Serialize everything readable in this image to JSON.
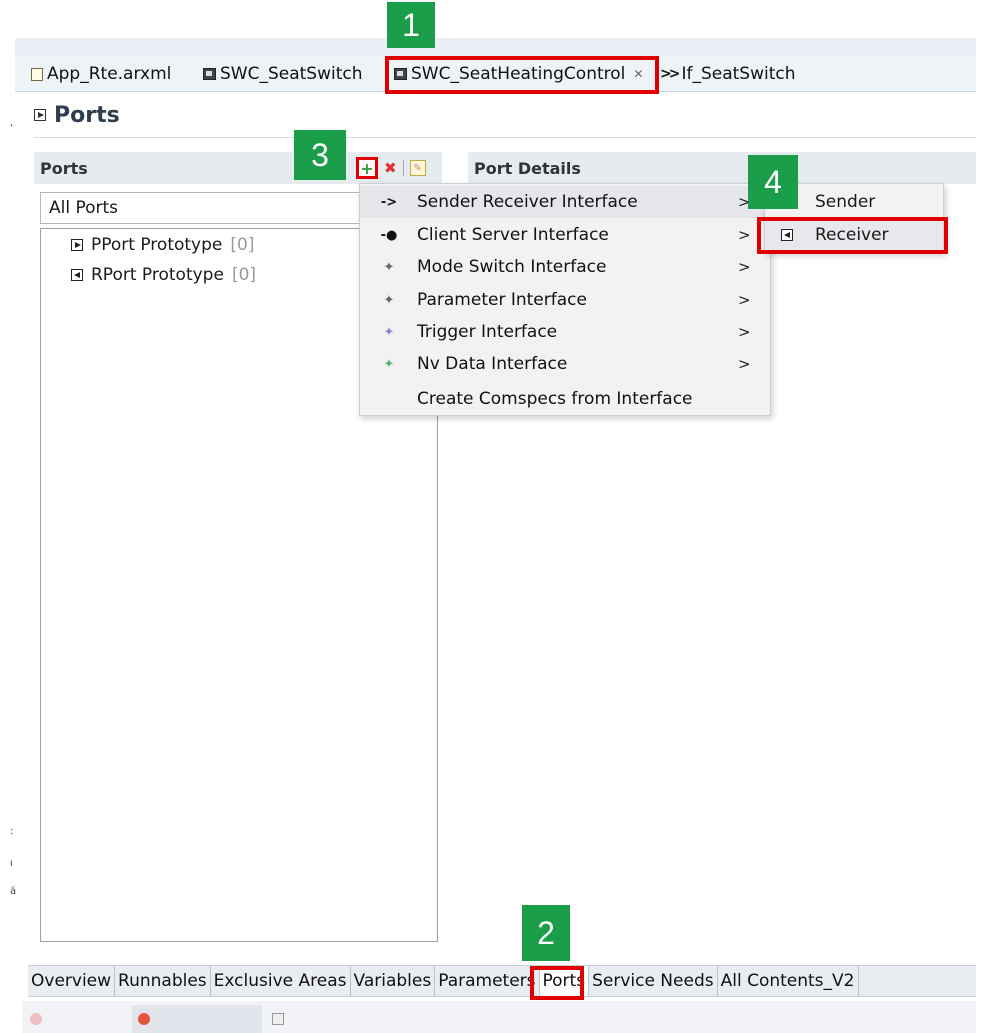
{
  "editor_tabs": [
    {
      "label": "App_Rte.arxml",
      "icon": "arxml-file-icon"
    },
    {
      "label": "SWC_SeatSwitch",
      "icon": "component-icon"
    },
    {
      "label": "SWC_SeatHeatingControl",
      "icon": "component-icon",
      "close": "✕"
    },
    {
      "label": "If_SeatSwitch",
      "icon": "sender-receiver-interface-icon"
    }
  ],
  "page": {
    "title": "Ports"
  },
  "ports_panel": {
    "header": "Ports",
    "filter_value": "All Ports",
    "tree": [
      {
        "label": "PPort Prototype",
        "count": "[0]",
        "icon": "provided-port-icon"
      },
      {
        "label": "RPort Prototype",
        "count": "[0]",
        "icon": "required-port-icon"
      }
    ],
    "toolbar": {
      "add": "add-icon",
      "delete": "delete-icon",
      "edit": "edit-icon"
    }
  },
  "details_panel": {
    "header": "Port Details"
  },
  "context_menu": {
    "items": [
      {
        "label": "Sender Receiver Interface",
        "has_submenu": true,
        "icon": "sender-receiver-icon"
      },
      {
        "label": "Client Server Interface",
        "has_submenu": true,
        "icon": "client-server-icon"
      },
      {
        "label": "Mode Switch Interface",
        "has_submenu": true,
        "icon": "mode-switch-icon"
      },
      {
        "label": "Parameter Interface",
        "has_submenu": true,
        "icon": "parameter-icon"
      },
      {
        "label": "Trigger Interface",
        "has_submenu": true,
        "icon": "trigger-icon"
      },
      {
        "label": "Nv Data Interface",
        "has_submenu": true,
        "icon": "nv-data-icon"
      },
      {
        "label": "Create Comspecs from Interface",
        "has_submenu": false,
        "icon": ""
      }
    ],
    "chevron": ">"
  },
  "submenu": {
    "items": [
      {
        "label": "Sender",
        "icon": "sender-icon"
      },
      {
        "label": "Receiver",
        "icon": "receiver-icon"
      }
    ]
  },
  "bottom_tabs": [
    "Overview",
    "Runnables",
    "Exclusive Areas",
    "Variables",
    "Parameters",
    "Ports",
    "Service Needs",
    "All Contents_V2"
  ],
  "active_bottom_tab": "Ports",
  "step_badges": [
    "1",
    "2",
    "3",
    "4"
  ],
  "colors": {
    "highlight_red": "#e00000",
    "badge_green": "#1a9e4a",
    "panel_header": "#e6ebf0"
  }
}
